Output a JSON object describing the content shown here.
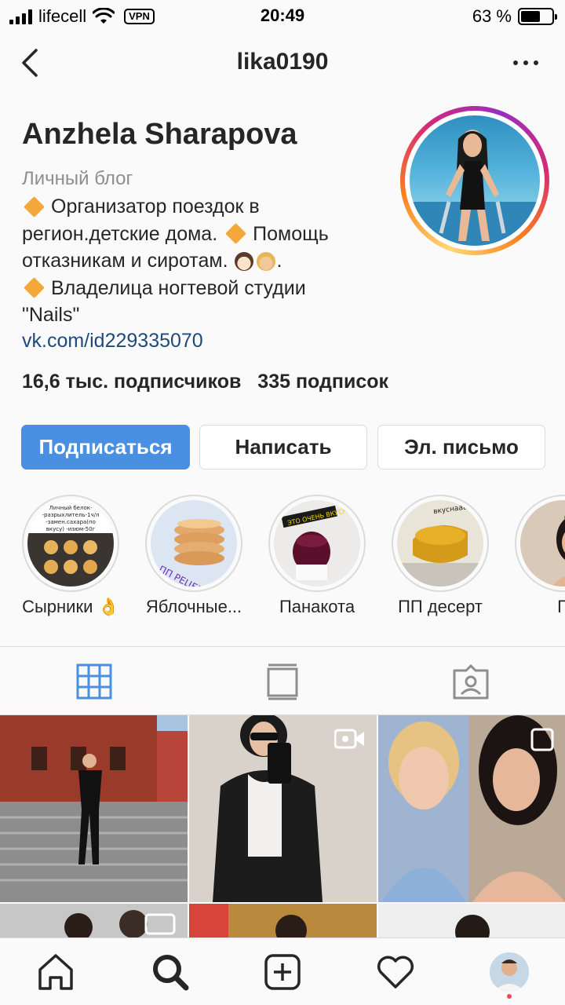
{
  "status_bar": {
    "carrier": "lifecell",
    "vpn": "VPN",
    "time": "20:49",
    "battery_text": "63 %",
    "battery_level": 0.63
  },
  "header": {
    "username": "lika0190"
  },
  "profile": {
    "display_name": "Anzhela Sharapova",
    "category": "Личный блог",
    "bio_lines": [
      "Организатор поездок в",
      "регион.детские дома.",
      "Помощь",
      "отказникам и сиротам.",
      "Владелица ногтевой студии",
      "\"Nails\""
    ],
    "link": "vk.com/id229335070",
    "followers": "16,6 тыс. подписчиков",
    "following": "335 подписок"
  },
  "actions": {
    "follow": "Подписаться",
    "message": "Написать",
    "email": "Эл. письмо"
  },
  "highlights": [
    {
      "label": "Сырники 👌",
      "cover_text": "Личный белок-разрыхлитель-1ч/л-замен.сахара(по вкусу)-изюм-50г"
    },
    {
      "label": "Яблочные...",
      "cover_text": "ПП РЕЦЕПТ"
    },
    {
      "label": "Панакота",
      "cover_text": "ЭТО ОЧЕНЬ ВКУСНО"
    },
    {
      "label": "ПП десерт",
      "cover_text": "вкуснааа"
    },
    {
      "label": "П",
      "cover_text": ""
    }
  ],
  "tabs": [
    "grid",
    "feed",
    "tagged"
  ],
  "colors": {
    "accent": "#4a90e2",
    "text": "#262626",
    "muted": "#8e8e8e",
    "link": "#1f4a7b",
    "border": "#dbdbdb",
    "notification": "#ed4956"
  }
}
